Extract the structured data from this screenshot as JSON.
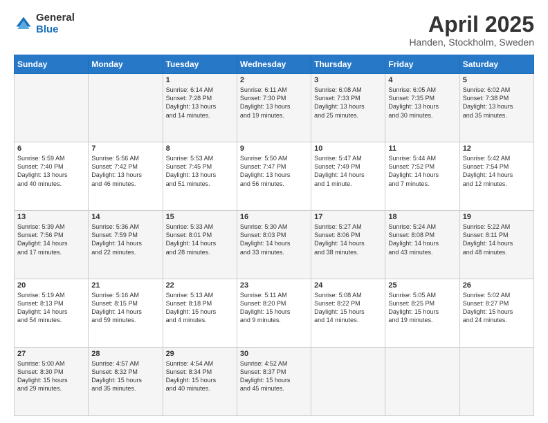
{
  "header": {
    "logo_general": "General",
    "logo_blue": "Blue",
    "month_year": "April 2025",
    "location": "Handen, Stockholm, Sweden"
  },
  "days_of_week": [
    "Sunday",
    "Monday",
    "Tuesday",
    "Wednesday",
    "Thursday",
    "Friday",
    "Saturday"
  ],
  "weeks": [
    [
      {
        "day": "",
        "info": ""
      },
      {
        "day": "",
        "info": ""
      },
      {
        "day": "1",
        "info": "Sunrise: 6:14 AM\nSunset: 7:28 PM\nDaylight: 13 hours\nand 14 minutes."
      },
      {
        "day": "2",
        "info": "Sunrise: 6:11 AM\nSunset: 7:30 PM\nDaylight: 13 hours\nand 19 minutes."
      },
      {
        "day": "3",
        "info": "Sunrise: 6:08 AM\nSunset: 7:33 PM\nDaylight: 13 hours\nand 25 minutes."
      },
      {
        "day": "4",
        "info": "Sunrise: 6:05 AM\nSunset: 7:35 PM\nDaylight: 13 hours\nand 30 minutes."
      },
      {
        "day": "5",
        "info": "Sunrise: 6:02 AM\nSunset: 7:38 PM\nDaylight: 13 hours\nand 35 minutes."
      }
    ],
    [
      {
        "day": "6",
        "info": "Sunrise: 5:59 AM\nSunset: 7:40 PM\nDaylight: 13 hours\nand 40 minutes."
      },
      {
        "day": "7",
        "info": "Sunrise: 5:56 AM\nSunset: 7:42 PM\nDaylight: 13 hours\nand 46 minutes."
      },
      {
        "day": "8",
        "info": "Sunrise: 5:53 AM\nSunset: 7:45 PM\nDaylight: 13 hours\nand 51 minutes."
      },
      {
        "day": "9",
        "info": "Sunrise: 5:50 AM\nSunset: 7:47 PM\nDaylight: 13 hours\nand 56 minutes."
      },
      {
        "day": "10",
        "info": "Sunrise: 5:47 AM\nSunset: 7:49 PM\nDaylight: 14 hours\nand 1 minute."
      },
      {
        "day": "11",
        "info": "Sunrise: 5:44 AM\nSunset: 7:52 PM\nDaylight: 14 hours\nand 7 minutes."
      },
      {
        "day": "12",
        "info": "Sunrise: 5:42 AM\nSunset: 7:54 PM\nDaylight: 14 hours\nand 12 minutes."
      }
    ],
    [
      {
        "day": "13",
        "info": "Sunrise: 5:39 AM\nSunset: 7:56 PM\nDaylight: 14 hours\nand 17 minutes."
      },
      {
        "day": "14",
        "info": "Sunrise: 5:36 AM\nSunset: 7:59 PM\nDaylight: 14 hours\nand 22 minutes."
      },
      {
        "day": "15",
        "info": "Sunrise: 5:33 AM\nSunset: 8:01 PM\nDaylight: 14 hours\nand 28 minutes."
      },
      {
        "day": "16",
        "info": "Sunrise: 5:30 AM\nSunset: 8:03 PM\nDaylight: 14 hours\nand 33 minutes."
      },
      {
        "day": "17",
        "info": "Sunrise: 5:27 AM\nSunset: 8:06 PM\nDaylight: 14 hours\nand 38 minutes."
      },
      {
        "day": "18",
        "info": "Sunrise: 5:24 AM\nSunset: 8:08 PM\nDaylight: 14 hours\nand 43 minutes."
      },
      {
        "day": "19",
        "info": "Sunrise: 5:22 AM\nSunset: 8:11 PM\nDaylight: 14 hours\nand 48 minutes."
      }
    ],
    [
      {
        "day": "20",
        "info": "Sunrise: 5:19 AM\nSunset: 8:13 PM\nDaylight: 14 hours\nand 54 minutes."
      },
      {
        "day": "21",
        "info": "Sunrise: 5:16 AM\nSunset: 8:15 PM\nDaylight: 14 hours\nand 59 minutes."
      },
      {
        "day": "22",
        "info": "Sunrise: 5:13 AM\nSunset: 8:18 PM\nDaylight: 15 hours\nand 4 minutes."
      },
      {
        "day": "23",
        "info": "Sunrise: 5:11 AM\nSunset: 8:20 PM\nDaylight: 15 hours\nand 9 minutes."
      },
      {
        "day": "24",
        "info": "Sunrise: 5:08 AM\nSunset: 8:22 PM\nDaylight: 15 hours\nand 14 minutes."
      },
      {
        "day": "25",
        "info": "Sunrise: 5:05 AM\nSunset: 8:25 PM\nDaylight: 15 hours\nand 19 minutes."
      },
      {
        "day": "26",
        "info": "Sunrise: 5:02 AM\nSunset: 8:27 PM\nDaylight: 15 hours\nand 24 minutes."
      }
    ],
    [
      {
        "day": "27",
        "info": "Sunrise: 5:00 AM\nSunset: 8:30 PM\nDaylight: 15 hours\nand 29 minutes."
      },
      {
        "day": "28",
        "info": "Sunrise: 4:57 AM\nSunset: 8:32 PM\nDaylight: 15 hours\nand 35 minutes."
      },
      {
        "day": "29",
        "info": "Sunrise: 4:54 AM\nSunset: 8:34 PM\nDaylight: 15 hours\nand 40 minutes."
      },
      {
        "day": "30",
        "info": "Sunrise: 4:52 AM\nSunset: 8:37 PM\nDaylight: 15 hours\nand 45 minutes."
      },
      {
        "day": "",
        "info": ""
      },
      {
        "day": "",
        "info": ""
      },
      {
        "day": "",
        "info": ""
      }
    ]
  ]
}
